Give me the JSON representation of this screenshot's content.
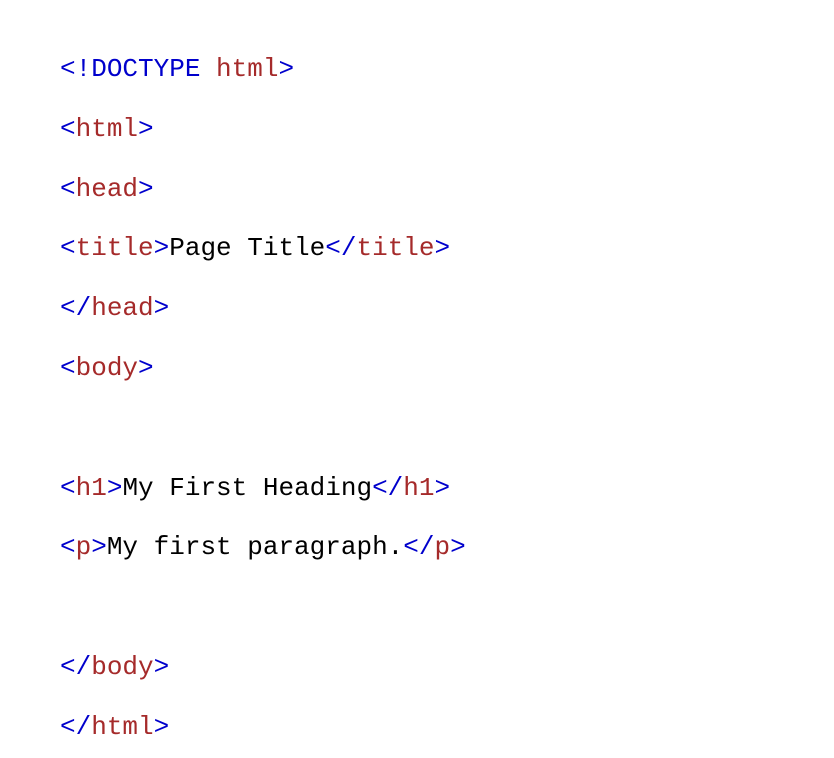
{
  "code": {
    "line1": {
      "t1": "<!",
      "t2": "DOCTYPE",
      "t3": " ",
      "t4": "html",
      "t5": ">"
    },
    "line2": {
      "t1": "<",
      "t2": "html",
      "t3": ">"
    },
    "line3": {
      "t1": "<",
      "t2": "head",
      "t3": ">"
    },
    "line4": {
      "t1": "<",
      "t2": "title",
      "t3": ">",
      "t4": "Page Title",
      "t5": "</",
      "t6": "title",
      "t7": ">"
    },
    "line5": {
      "t1": "</",
      "t2": "head",
      "t3": ">"
    },
    "line6": {
      "t1": "<",
      "t2": "body",
      "t3": ">"
    },
    "line8": {
      "t1": "<",
      "t2": "h1",
      "t3": ">",
      "t4": "My First Heading",
      "t5": "</",
      "t6": "h1",
      "t7": ">"
    },
    "line9": {
      "t1": "<",
      "t2": "p",
      "t3": ">",
      "t4": "My first paragraph.",
      "t5": "</",
      "t6": "p",
      "t7": ">"
    },
    "line11": {
      "t1": "</",
      "t2": "body",
      "t3": ">"
    },
    "line12": {
      "t1": "</",
      "t2": "html",
      "t3": ">"
    }
  }
}
